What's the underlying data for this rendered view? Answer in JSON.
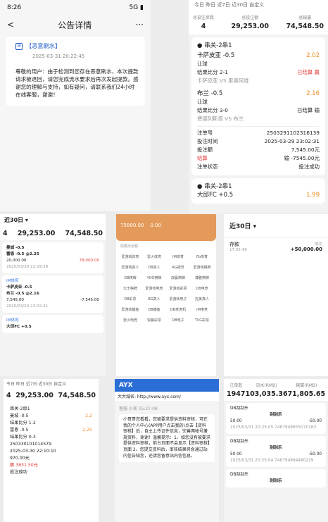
{
  "notice": {
    "status_time": "8:26",
    "status_right": "5G ▮",
    "back": "<",
    "title": "公告详情",
    "more": "···",
    "msg_title": "【恶意刷水】",
    "msg_time": "2025-03-31 20:22:45",
    "msg_body": "尊敬的用户：由于检测到您存在恶意刷水，本次提款请求被退回，请您完成流水要求后再次发起提款。感谢您的理解与支持，如有疑问，请联系我们24小时在线客服，谢谢！"
  },
  "slip": {
    "tabs": "今日  昨日  近7日  近30日  自定义",
    "sum_labels": [
      "总投注单数",
      "总投注额",
      "总输赢"
    ],
    "sum_values": [
      "4",
      "29,253.00",
      "74,548.50"
    ],
    "group1": "串关-2串1",
    "legs": [
      {
        "team": "卡萨皮亚 -0.5",
        "odds": "2.02",
        "type": "让球",
        "score": "结果比分  2-1",
        "status": "已结算 赢",
        "match": "卡萨皮亚 VS 里奥阿维"
      },
      {
        "team": "布兰 -0.5",
        "odds": "2.16",
        "type": "让球",
        "score": "结果比分  3-0",
        "status": "已结算 输",
        "match": "费德列斯塔 VS 布兰"
      }
    ],
    "bet_no_l": "注单号",
    "bet_no": "250329110231613​9",
    "time_l": "投注时间",
    "time": "2025-03-29 23:02:31",
    "amt_l": "投注额",
    "amt": "7,545.00元",
    "res_l": "结算",
    "res": "输 -7545.00元",
    "state_l": "注单状态",
    "state": "投注成功",
    "group2": "串关-2串1",
    "leg3": "大邱FC +0.5",
    "leg3_odds": "1.99"
  },
  "c": {
    "head": "近30日 ▾",
    "sum_values": [
      "4",
      "29,253.00",
      "74,548.50"
    ],
    "a1": "曼城 -0.5",
    "a2": "雷恩 -0.5 @2.25",
    "amt1": "20,000.00",
    "win1": "78,000.00",
    "date1": "2025/03/30 22:09:39",
    "im": "IM体育",
    "b1": "卡萨皮亚 -0.5",
    "b2": "布兰 -0.5 @2.16",
    "amt2": "7,545.00",
    "win2": "-7,545.00",
    "date2": "2025/03/29 23:02:31",
    "c1": "大邱FC +0.5"
  },
  "d": {
    "bal": "75800.00",
    "bal2": "0.00",
    "hide": "隐藏无余额",
    "items": [
      "爱游戏体育",
      "雷火体育",
      "IM体育",
      "Fb体育",
      "爱游戏真人",
      "DB真人",
      "AG视讯",
      "爱游戏棋牌",
      "DB棋牌",
      "YOO棋牌",
      "双赢棋牌",
      "博雅棋牌",
      "大王棋牌",
      "爱游戏电竞",
      "爱游戏彩票",
      "DB电竞",
      "DB彩票",
      "BG真人",
      "爱游戏电子",
      "完美真人",
      "爱游戏捕鱼",
      "DB捕鱼",
      "DB老虎机",
      "IM电竞",
      "雷火电竞",
      "双赢彩票",
      "DB电子",
      "TCG彩票"
    ]
  },
  "e": {
    "head": "近30日 ▾",
    "item": "存款",
    "time": "17:05:49",
    "status": "成功",
    "amount": "+50,000.00"
  },
  "f": {
    "tabs": "今日  昨日  近7日  近30日  自定义",
    "sum": [
      "4",
      "29,253.00",
      "74,548.50"
    ],
    "group": "串关-2串1",
    "l1": "曼城 -0.5",
    "l1o": "2.2",
    "l1s": "结果比分  1-2",
    "l2": "雷恩 -0.5",
    "l2o": "2.25",
    "l2s": "结果比分  0-3",
    "no": "250330101014579",
    "time": "2025-03-30 22:10:10",
    "amt": "970.00元",
    "res": "赢 3831.50元",
    "state": "投注成功"
  },
  "g": {
    "brand": "AYX",
    "url": "大大域名: http://www.ayx.com/",
    "sender": "客服 小美 15:27:08",
    "msg": "小哥哥您看看，您被要求提供资料审核，可在我的个人中心(APP用户点击我的)点击【资料审核】后，自主上传证件信息，完善两帐号兼规资料，谢谢！温馨提示：1、如您没有被要求提供资料审核，前台页面不会显示【资料审核】页面 2、您提交资料后，审核结果将会通过站内信告知您，还请您留意站内信信息。"
  },
  "h": {
    "sum_labels": [
      "注单数",
      "流水(RMB)",
      "输赢(RMB)"
    ],
    "sum": [
      "1947",
      "103,035.36",
      "71,805.65"
    ],
    "game": "DB刮刮乐",
    "name": "刮刮乐",
    "amt": "50.00",
    "win": "-50.00",
    "date1": "2025/03/31 20:25:05",
    "no1": "7487948655070163",
    "date2": "2025/03/31 20:25:04",
    "no2": "748794864480229"
  }
}
